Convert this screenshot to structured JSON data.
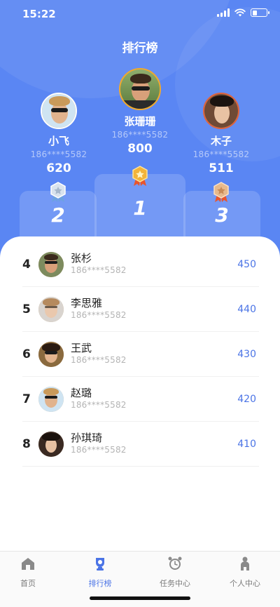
{
  "status": {
    "time": "15:22"
  },
  "header": {
    "title": "排行榜"
  },
  "podium": [
    {
      "rank": "1",
      "name": "张珊珊",
      "phone": "186****5582",
      "score": "800",
      "medal": "gold"
    },
    {
      "rank": "2",
      "name": "小飞",
      "phone": "186****5582",
      "score": "620",
      "medal": "silver"
    },
    {
      "rank": "3",
      "name": "木子",
      "phone": "186****5582",
      "score": "511",
      "medal": "bronze"
    }
  ],
  "list": [
    {
      "rank": "4",
      "name": "张杉",
      "phone": "186****5582",
      "score": "450"
    },
    {
      "rank": "5",
      "name": "李思雅",
      "phone": "186****5582",
      "score": "440"
    },
    {
      "rank": "6",
      "name": "王武",
      "phone": "186****5582",
      "score": "430"
    },
    {
      "rank": "7",
      "name": "赵璐",
      "phone": "186****5582",
      "score": "420"
    },
    {
      "rank": "8",
      "name": "孙琪琦",
      "phone": "186****5582",
      "score": "410"
    }
  ],
  "tabs": [
    {
      "label": "首页",
      "icon": "home-icon"
    },
    {
      "label": "排行榜",
      "icon": "trophy-icon",
      "active": true
    },
    {
      "label": "任务中心",
      "icon": "alarm-clock-icon"
    },
    {
      "label": "个人中心",
      "icon": "person-icon"
    }
  ],
  "colors": {
    "accent": "#5a86f3",
    "score": "#4b74e6",
    "gold": "#f0a92c"
  }
}
